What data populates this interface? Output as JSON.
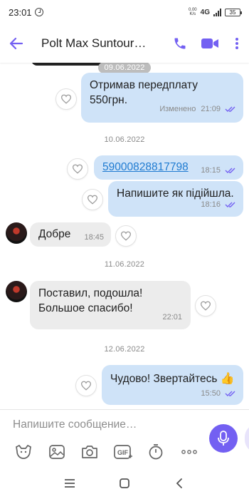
{
  "status_bar": {
    "time": "23:01",
    "speed_top": "0.00",
    "speed_bottom": "K/s",
    "network": "4G",
    "battery": "35"
  },
  "header": {
    "title": "Polt Max Suntour…",
    "icons": [
      "back-arrow-icon",
      "phone-icon",
      "video-icon",
      "more-vert-icon"
    ]
  },
  "messages": [
    {
      "type": "date",
      "label": "09.06.2022"
    },
    {
      "type": "out",
      "text": "Отримав передплату 550грн.",
      "edited": "Изменено",
      "time": "21:09"
    },
    {
      "type": "date",
      "label": "10.06.2022"
    },
    {
      "type": "out",
      "text": "59000828817798",
      "time": "18:15",
      "is_link": true
    },
    {
      "type": "out",
      "text": "Напишите як підійшла.",
      "time": "18:16"
    },
    {
      "type": "in",
      "text": "Добре",
      "time": "18:45"
    },
    {
      "type": "date",
      "label": "11.06.2022"
    },
    {
      "type": "in",
      "text": "Поставил, подошла! Большое спасибо!",
      "time": "22:01"
    },
    {
      "type": "date",
      "label": "12.06.2022"
    },
    {
      "type": "out",
      "text": "Чудово! Звертайтесь",
      "emoji": "👍",
      "time": "15:50"
    }
  ],
  "composer": {
    "placeholder": "Напишите сообщение…",
    "tools": [
      "sticker-icon",
      "gallery-icon",
      "camera-icon",
      "gif-icon",
      "timer-icon",
      "more-horiz-icon"
    ],
    "gif_label": "GIF"
  },
  "colors": {
    "accent": "#7360f2",
    "outgoing": "#cfe3f8",
    "incoming": "#ececec",
    "link": "#1f7bd1"
  }
}
